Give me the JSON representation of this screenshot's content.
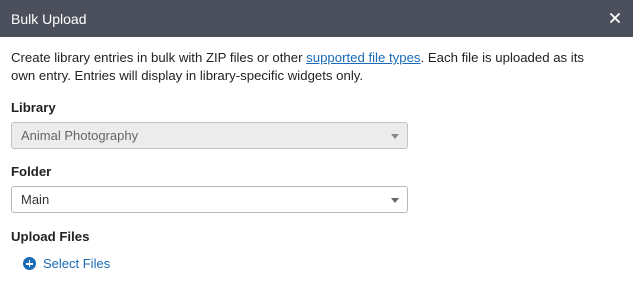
{
  "dialog": {
    "title": "Bulk Upload",
    "close_symbol": "×",
    "close_icon": "close-icon"
  },
  "description": {
    "before_link": "Create library entries in bulk with ZIP files or other ",
    "link_text": "supported file types",
    "after_link": ". Each file is uploaded as its own entry. Entries will display in library-specific widgets only."
  },
  "library": {
    "label": "Library",
    "value": "Animal Photography",
    "disabled": true
  },
  "folder": {
    "label": "Folder",
    "value": "Main"
  },
  "upload": {
    "label": "Upload Files",
    "button_label": "Select Files",
    "icon": "plus-circle-icon"
  },
  "colors": {
    "titlebar": "#4b505c",
    "link": "#1a6bb8"
  }
}
